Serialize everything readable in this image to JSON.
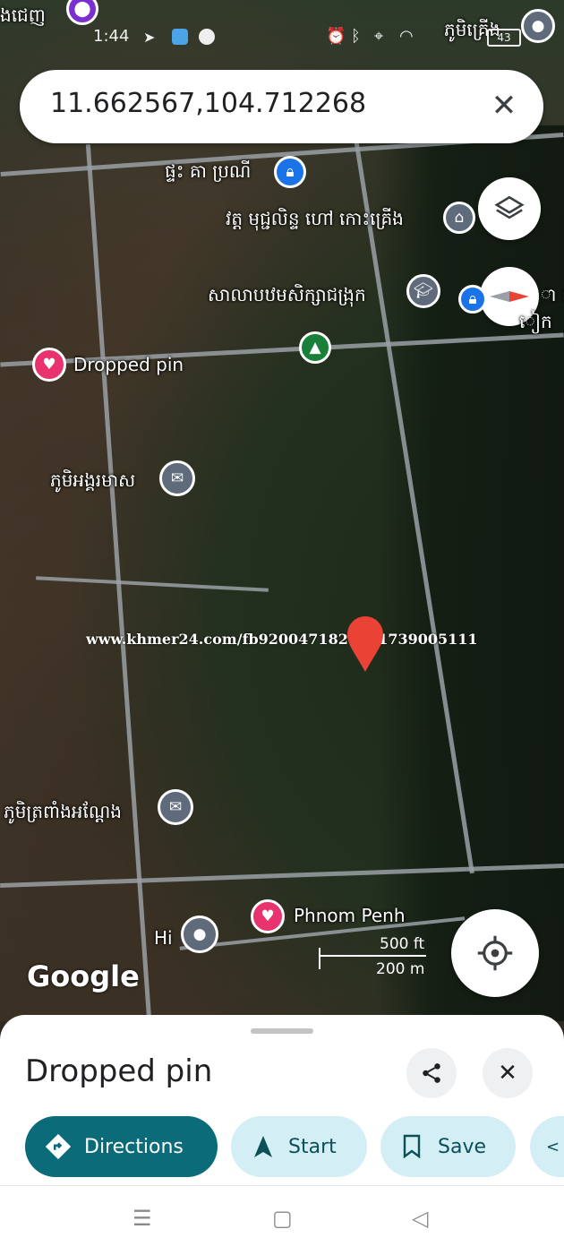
{
  "status_bar": {
    "time": "1:44",
    "battery": "43"
  },
  "search": {
    "query": "11.662567,104.712268"
  },
  "map_labels": {
    "top_left": "ងជេញ",
    "top_right": "ភូមិគ្រើង",
    "house": "ផ្ទះ គា ប្រណី",
    "temple": "វត្ត មុជ្ជលិន្ទ ហៅ កោះគ្រើង",
    "school": "សាលាបឋមសិក្សាជង្រុក",
    "right_edge_1": "ា ល",
    "right_edge_2": "ៀក",
    "pin_saved": "Dropped pin",
    "village_1": "ភូមិអង្គរមាស",
    "village_2": "ភូមិត្រពាំងអណ្តែង",
    "phnom_penh": "Phnom Penh",
    "hi": "Hi"
  },
  "watermark": "www.khmer24.com/fb9200471829971739005111",
  "google_logo": "Google",
  "scale": {
    "ft": "500 ft",
    "m": "200 m"
  },
  "sheet": {
    "title": "Dropped pin",
    "buttons": {
      "directions": "Directions",
      "start": "Start",
      "save": "Save"
    }
  },
  "colors": {
    "accent": "#0b6b79",
    "pill_bg": "#d3eef5",
    "pin_red": "#ea4335",
    "poi_blue": "#1a73e8",
    "poi_gray": "#5f6b7a",
    "poi_green": "#188038",
    "poi_pink": "#e8336f"
  }
}
